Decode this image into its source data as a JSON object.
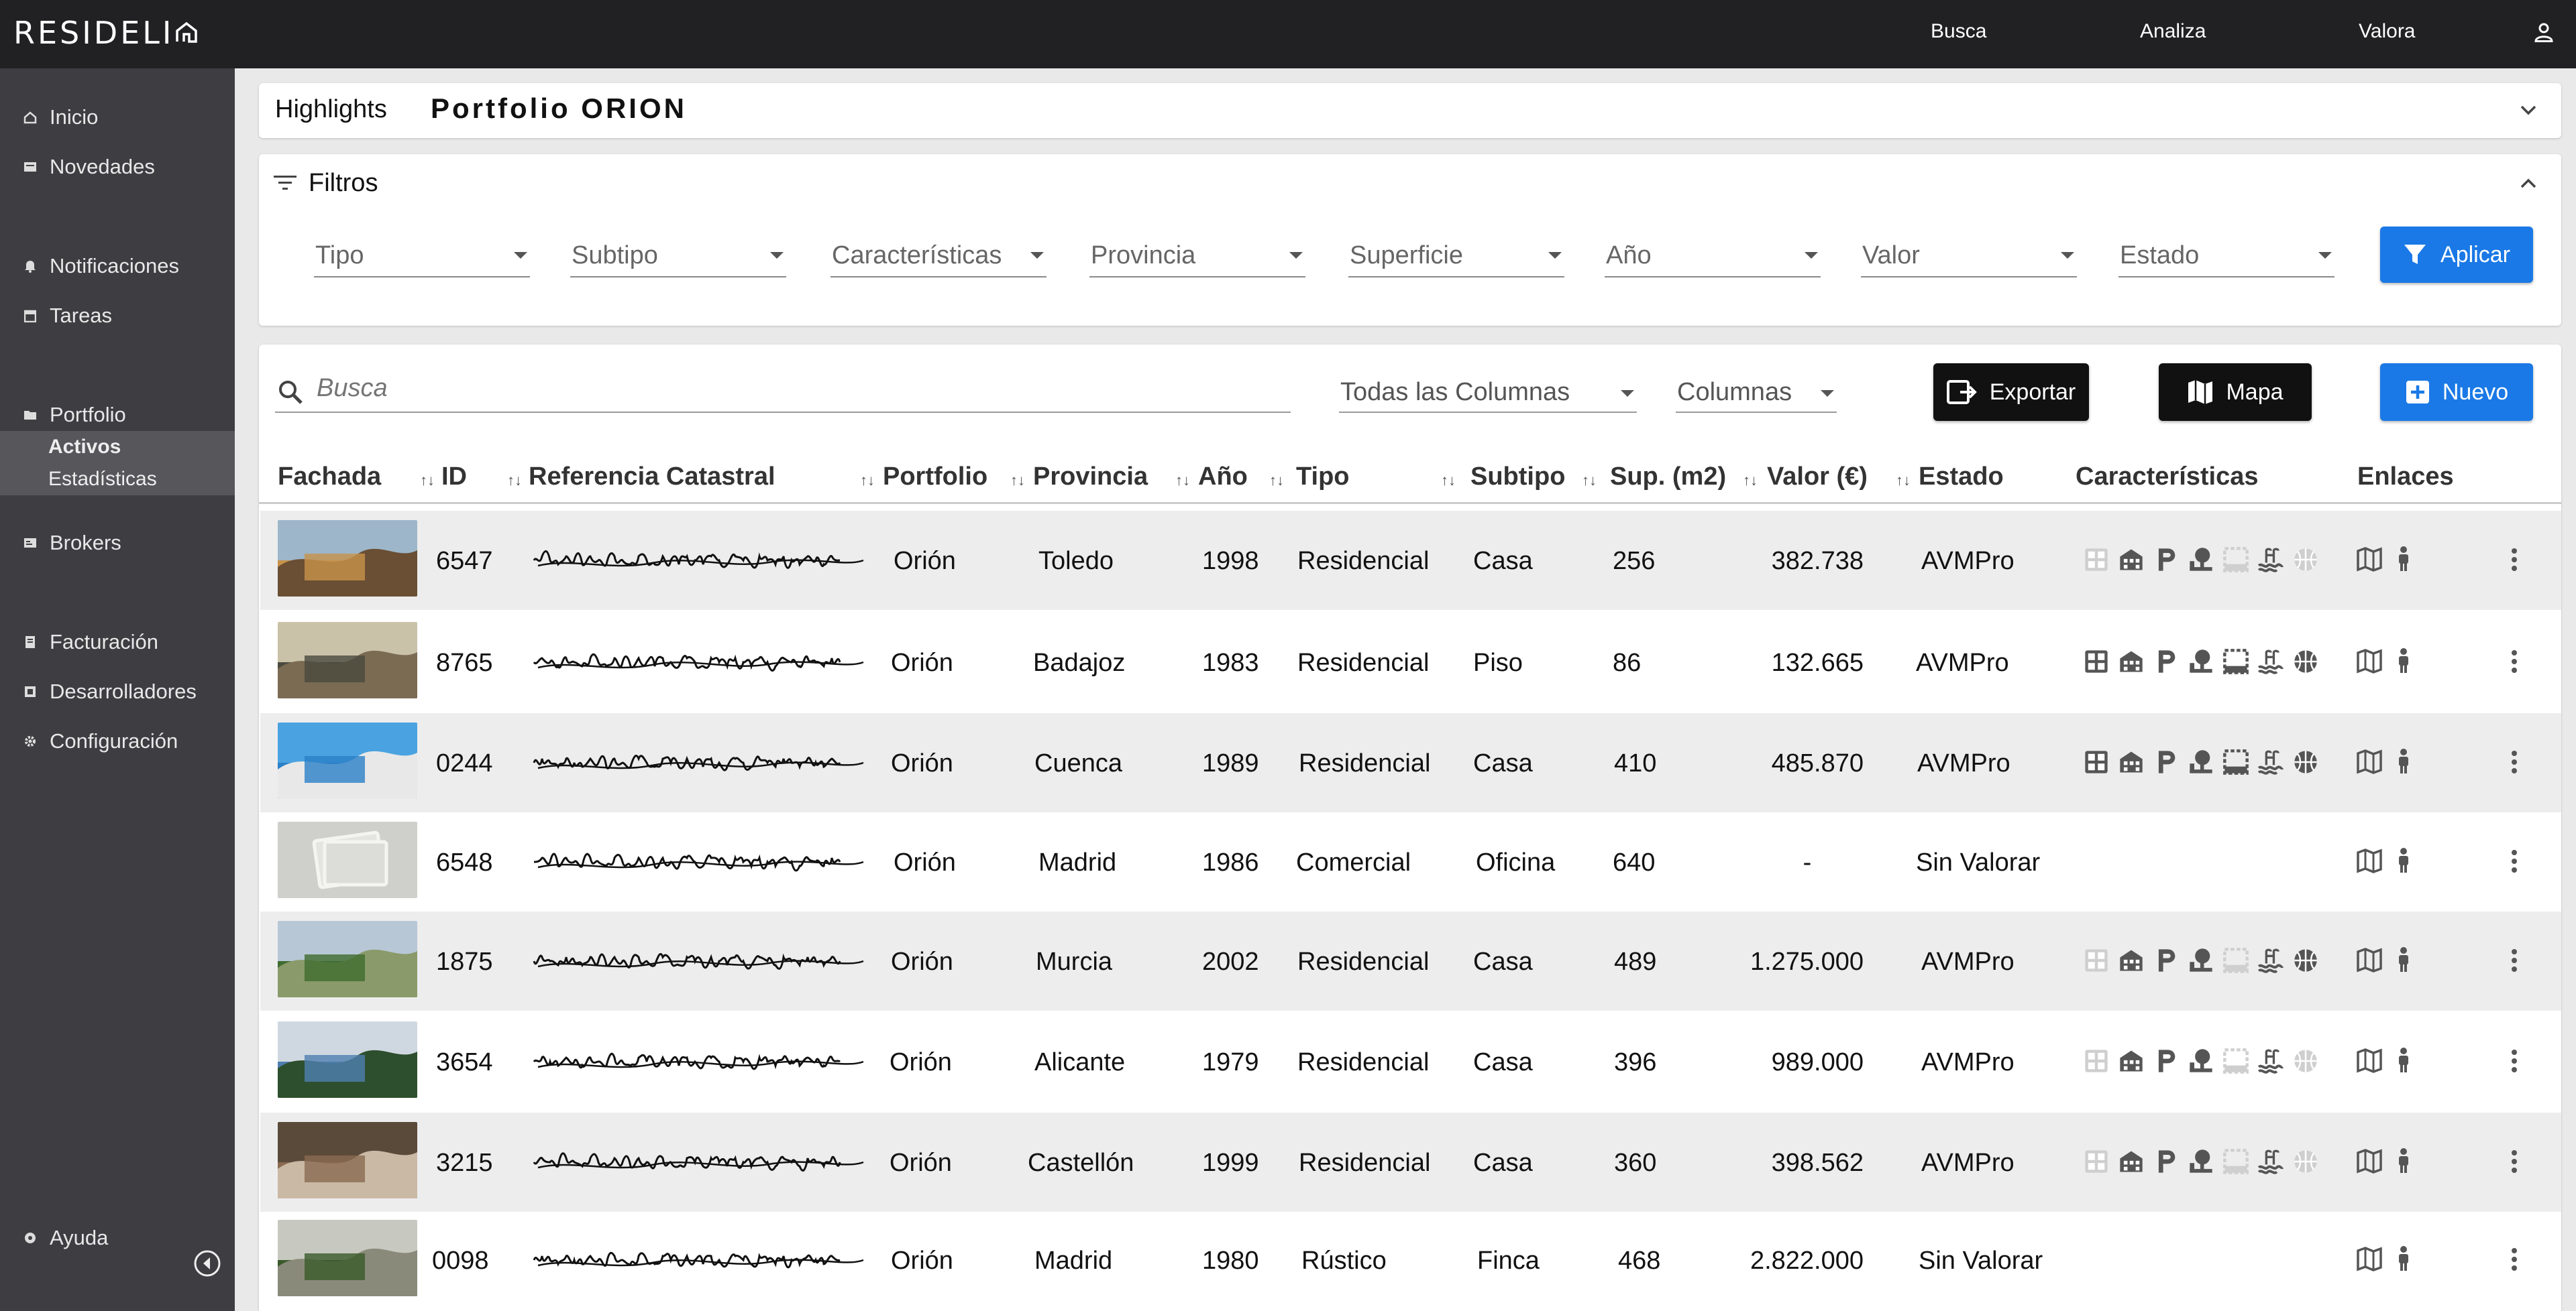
{
  "app": {
    "logo": "RESIDELI"
  },
  "topnav": {
    "busca": "Busca",
    "analiza": "Analiza",
    "valora": "Valora"
  },
  "sidebar": {
    "inicio": "Inicio",
    "novedades": "Novedades",
    "notificaciones": "Notificaciones",
    "tareas": "Tareas",
    "portfolio": "Portfolio",
    "activos": "Activos",
    "estadisticas": "Estadísticas",
    "brokers": "Brokers",
    "facturacion": "Facturación",
    "desarrolladores": "Desarrolladores",
    "configuracion": "Configuración",
    "ayuda": "Ayuda"
  },
  "highlights": {
    "label": "Highlights",
    "title": "Portfolio ORION"
  },
  "filters": {
    "title": "Filtros",
    "tipo": "Tipo",
    "subtipo": "Subtipo",
    "caracteristicas": "Características",
    "provincia": "Provincia",
    "superficie": "Superficie",
    "anio": "Año",
    "valor": "Valor",
    "estado": "Estado",
    "apply": "Aplicar"
  },
  "toolbar": {
    "search_placeholder": "Busca",
    "all_columns": "Todas las Columnas",
    "columns": "Columnas",
    "export": "Exportar",
    "map": "Mapa",
    "new": "Nuevo"
  },
  "table": {
    "headers": {
      "fachada": "Fachada",
      "id": "ID",
      "referencia": "Referencia Catastral",
      "portfolio": "Portfolio",
      "provincia": "Provincia",
      "anio": "Año",
      "tipo": "Tipo",
      "subtipo": "Subtipo",
      "sup": "Sup. (m2)",
      "valor": "Valor (€)",
      "estado": "Estado",
      "caracteristicas": "Características",
      "enlaces": "Enlaces"
    },
    "rows": [
      {
        "id": "6547",
        "portfolio": "Orión",
        "provincia": "Toledo",
        "anio": "1998",
        "tipo": "Residencial",
        "subtipo": "Casa",
        "sup": "256",
        "valor": "382.738",
        "estado": "AVMPro"
      },
      {
        "id": "8765",
        "portfolio": "Orión",
        "provincia": "Badajoz",
        "anio": "1983",
        "tipo": "Residencial",
        "subtipo": "Piso",
        "sup": "86",
        "valor": "132.665",
        "estado": "AVMPro"
      },
      {
        "id": "0244",
        "portfolio": "Orión",
        "provincia": "Cuenca",
        "anio": "1989",
        "tipo": "Residencial",
        "subtipo": "Casa",
        "sup": "410",
        "valor": "485.870",
        "estado": "AVMPro"
      },
      {
        "id": "6548",
        "portfolio": "Orión",
        "provincia": "Madrid",
        "anio": "1986",
        "tipo": "Comercial",
        "subtipo": "Oficina",
        "sup": "640",
        "valor": "-",
        "estado": "Sin Valorar"
      },
      {
        "id": "1875",
        "portfolio": "Orión",
        "provincia": "Murcia",
        "anio": "2002",
        "tipo": "Residencial",
        "subtipo": "Casa",
        "sup": "489",
        "valor": "1.275.000",
        "estado": "AVMPro"
      },
      {
        "id": "3654",
        "portfolio": "Orión",
        "provincia": "Alicante",
        "anio": "1979",
        "tipo": "Residencial",
        "subtipo": "Casa",
        "sup": "396",
        "valor": "989.000",
        "estado": "AVMPro"
      },
      {
        "id": "3215",
        "portfolio": "Orión",
        "provincia": "Castellón",
        "anio": "1999",
        "tipo": "Residencial",
        "subtipo": "Casa",
        "sup": "360",
        "valor": "398.562",
        "estado": "AVMPro"
      },
      {
        "id": "0098",
        "portfolio": "Orión",
        "provincia": "Madrid",
        "anio": "1980",
        "tipo": "Rústico",
        "subtipo": "Finca",
        "sup": "468",
        "valor": "2.822.000",
        "estado": "Sin Valorar"
      }
    ]
  }
}
